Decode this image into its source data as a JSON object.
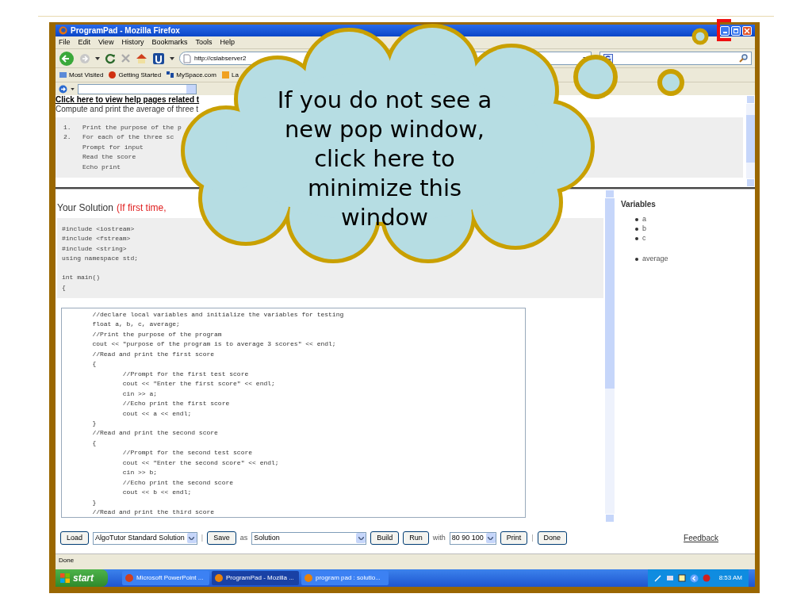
{
  "window": {
    "title": "ProgramPad - Mozilla Firefox"
  },
  "menu": [
    "File",
    "Edit",
    "View",
    "History",
    "Bookmarks",
    "Tools",
    "Help"
  ],
  "address_bar": {
    "url": "http://cslabserver2"
  },
  "bookmarks": [
    "Most Visited",
    "Getting Started",
    "MySpace.com",
    "La"
  ],
  "problem": {
    "help_link": "Click here to view help pages related t",
    "description": "Compute and print the average of three t",
    "steps": [
      {
        "number": "1.",
        "text": "Print the purpose of the p"
      },
      {
        "number": "2.",
        "text": "For each of the three sc",
        "children": [
          "Prompt for input",
          "Read the score",
          "Echo print"
        ]
      }
    ]
  },
  "solution": {
    "title": "Your Solution",
    "note": "(If first time,",
    "header_code": [
      [
        "#include <iostream>",
        "#include <fstream>",
        "#include <string>",
        "using namespace std;"
      ],
      [
        "int main()",
        "{"
      ]
    ],
    "editor_code": [
      "\t//declare local variables and initialize the variables for testing",
      "\tfloat a, b, c, average;",
      "\t//Print the purpose of the program",
      "\tcout << \"purpose of the program is to average 3 scores\" << endl;",
      "\t//Read and print the first score",
      "\t{",
      "\t\t//Prompt for the first test score",
      "\t\tcout << \"Enter the first score\" << endl;",
      "\t\tcin >> a;",
      "\t\t//Echo print the first score",
      "\t\tcout << a << endl;",
      "\t}",
      "\t//Read and print the second score",
      "\t{",
      "\t\t//Prompt for the second test score",
      "\t\tcout << \"Enter the second score\" << endl;",
      "\t\tcin >> b;",
      "\t\t//Echo print the second score",
      "\t\tcout << b << endl;",
      "\t}",
      "\t//Read and print the third score"
    ]
  },
  "variables": {
    "title": "Variables",
    "groups": [
      [
        "a",
        "b",
        "c"
      ],
      [
        "average"
      ]
    ]
  },
  "controls": [
    {
      "kind": "button",
      "label": "Load"
    },
    {
      "kind": "select",
      "value": "AlgoTutor Standard Solution"
    },
    {
      "kind": "separator",
      "label": "|"
    },
    {
      "kind": "button",
      "label": "Save"
    },
    {
      "kind": "text",
      "label": "as"
    },
    {
      "kind": "select",
      "value": "Solution",
      "wide": true
    },
    {
      "kind": "button",
      "label": "Build"
    },
    {
      "kind": "button",
      "label": "Run"
    },
    {
      "kind": "text",
      "label": "with"
    },
    {
      "kind": "select",
      "value": "80 90 100"
    },
    {
      "kind": "button",
      "label": "Print"
    },
    {
      "kind": "separator",
      "label": "|"
    },
    {
      "kind": "button",
      "label": "Done"
    }
  ],
  "feedback_link": "Feedback",
  "status_bar": "Done",
  "taskbar": {
    "start": "start",
    "items": [
      {
        "label": "Microsoft PowerPoint ...",
        "selected": false
      },
      {
        "label": "ProgramPad - Mozilla ...",
        "selected": true
      },
      {
        "label": "program pad : solutio...",
        "selected": false
      }
    ],
    "clock": "8:53 AM"
  },
  "callout": {
    "lines": [
      "If you do not see a",
      "new pop window,",
      "click here to",
      "minimize this",
      "window"
    ]
  }
}
